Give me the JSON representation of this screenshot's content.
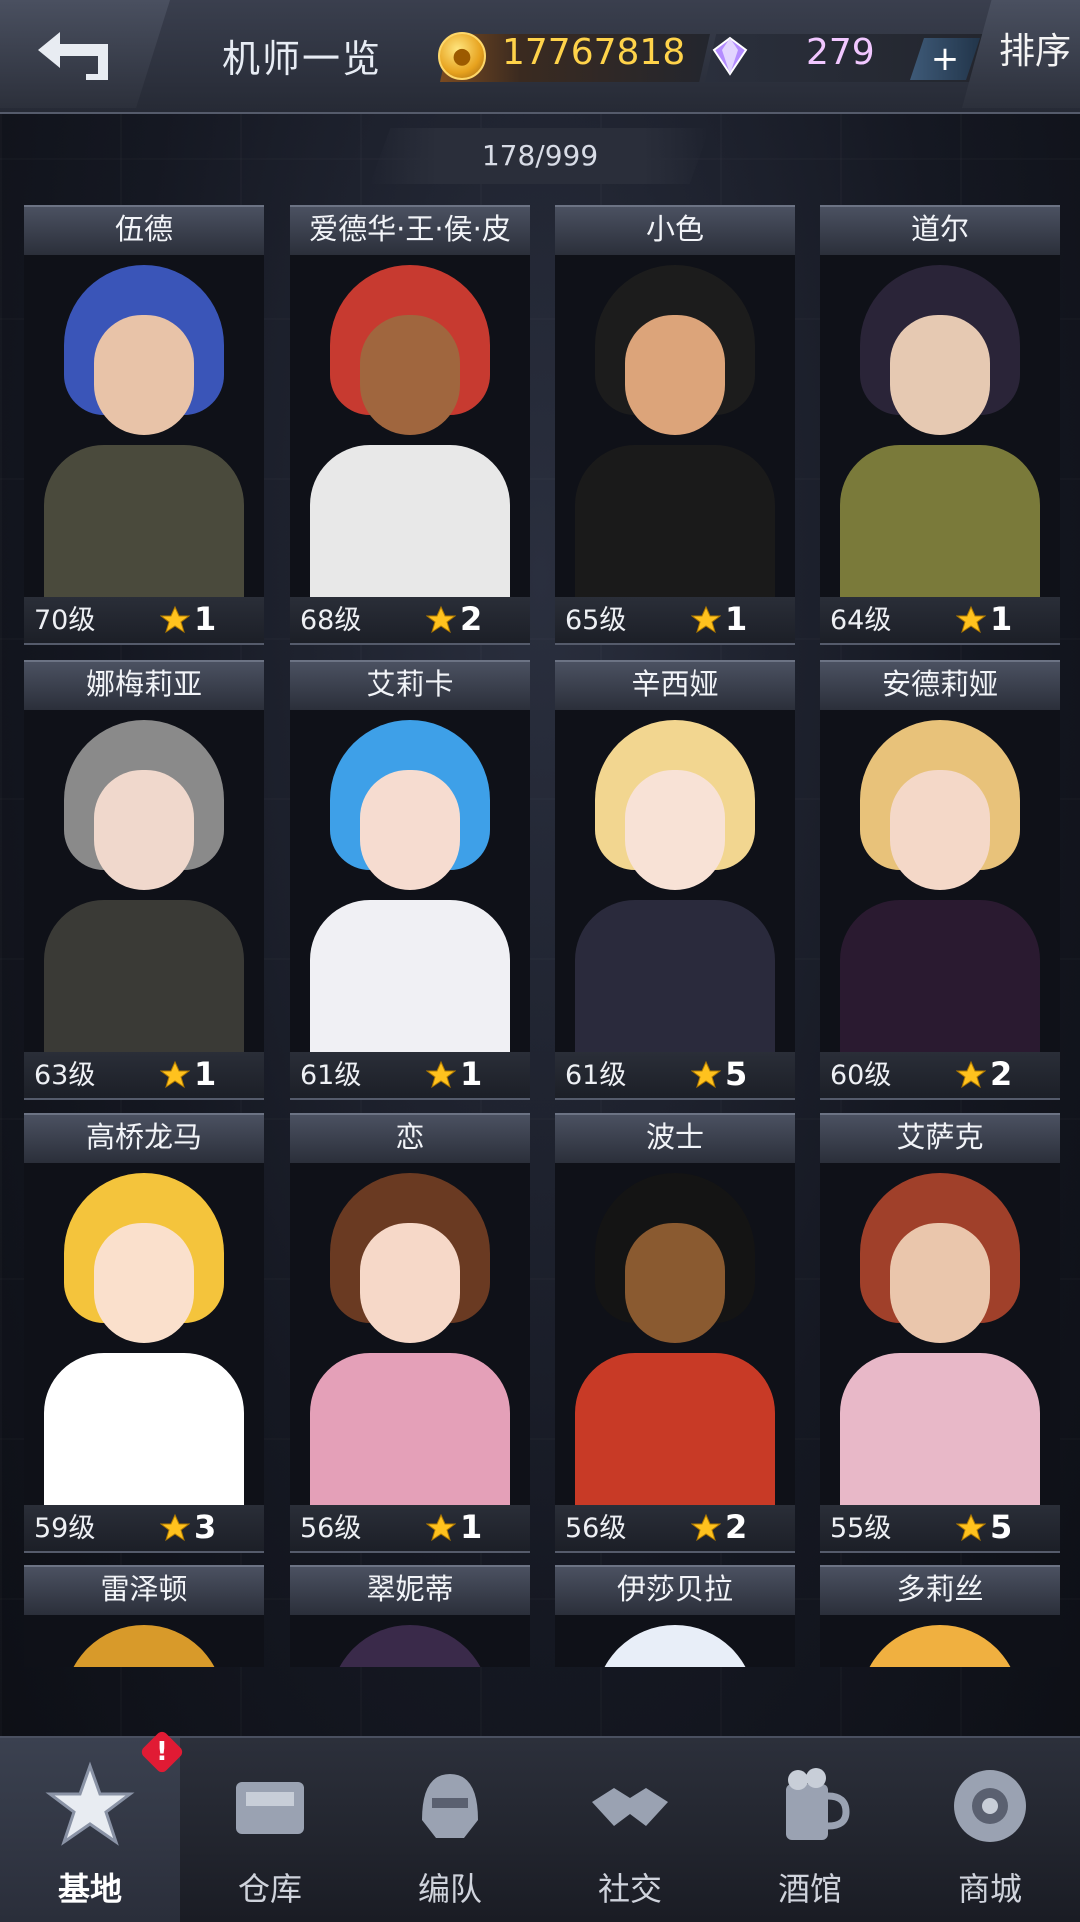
{
  "header": {
    "title": "机师一览",
    "coins": "17767818",
    "gems": "279",
    "plus_label": "+",
    "sort_label": "排序"
  },
  "roster_count": "178/999",
  "colors": {
    "accent_gold": "#ffd34a",
    "gem_text": "#f1c7ff",
    "badge_red": "#e11b34"
  },
  "pilots": [
    {
      "name": "伍德",
      "level": "70级",
      "stars": "1",
      "hair": "#3a55b8",
      "skin": "#e8c3a8",
      "outfit": "#4a4a3c"
    },
    {
      "name": "爱德华·王·侯·皮",
      "level": "68级",
      "stars": "2",
      "hair": "#c73a30",
      "skin": "#a0663e",
      "outfit": "#e8e8e8"
    },
    {
      "name": "小色",
      "level": "65级",
      "stars": "1",
      "hair": "#1c1c1c",
      "skin": "#dca47a",
      "outfit": "#1a1a1a"
    },
    {
      "name": "道尔",
      "level": "64级",
      "stars": "1",
      "hair": "#2a2438",
      "skin": "#e6c9b2",
      "outfit": "#7a7a3a"
    },
    {
      "name": "娜梅莉亚",
      "level": "63级",
      "stars": "1",
      "hair": "#8a8a8a",
      "skin": "#f0d8cc",
      "outfit": "#3a3a36"
    },
    {
      "name": "艾莉卡",
      "level": "61级",
      "stars": "1",
      "hair": "#3ea0e8",
      "skin": "#f6dcd0",
      "outfit": "#f0f0f4"
    },
    {
      "name": "辛西娅",
      "level": "61级",
      "stars": "5",
      "hair": "#f2d690",
      "skin": "#f8e2d6",
      "outfit": "#2a2a3c"
    },
    {
      "name": "安德莉娅",
      "level": "60级",
      "stars": "2",
      "hair": "#e8c27a",
      "skin": "#f4d8c8",
      "outfit": "#2a1a30"
    },
    {
      "name": "高桥龙马",
      "level": "59级",
      "stars": "3",
      "hair": "#f4c43c",
      "skin": "#fae0cc",
      "outfit": "#ffffff"
    },
    {
      "name": "恋",
      "level": "56级",
      "stars": "1",
      "hair": "#6a3a22",
      "skin": "#f6d8c8",
      "outfit": "#e4a0b8"
    },
    {
      "name": "波士",
      "level": "56级",
      "stars": "2",
      "hair": "#141414",
      "skin": "#8a5a30",
      "outfit": "#c83a26"
    },
    {
      "name": "艾萨克",
      "level": "55级",
      "stars": "5",
      "hair": "#a0402a",
      "skin": "#eac6ac",
      "outfit": "#e8b8c8"
    },
    {
      "name": "雷泽顿",
      "level": "",
      "stars": "",
      "hair": "#d89a2a",
      "skin": "#f0d0b0",
      "outfit": "#333333"
    },
    {
      "name": "翠妮蒂",
      "level": "",
      "stars": "",
      "hair": "#3a2a4a",
      "skin": "#f0d0c0",
      "outfit": "#333333"
    },
    {
      "name": "伊莎贝拉",
      "level": "",
      "stars": "",
      "hair": "#e8eef8",
      "skin": "#f4dcd0",
      "outfit": "#333333"
    },
    {
      "name": "多莉丝",
      "level": "",
      "stars": "",
      "hair": "#f0b040",
      "skin": "#f4d8c0",
      "outfit": "#333333"
    }
  ],
  "nav": [
    {
      "label": "基地",
      "icon": "base-emblem-icon",
      "badge": "!"
    },
    {
      "label": "仓库",
      "icon": "warehouse-icon"
    },
    {
      "label": "编队",
      "icon": "helmet-icon"
    },
    {
      "label": "社交",
      "icon": "handshake-icon"
    },
    {
      "label": "酒馆",
      "icon": "beer-mug-icon"
    },
    {
      "label": "商城",
      "icon": "shop-robot-icon"
    }
  ]
}
